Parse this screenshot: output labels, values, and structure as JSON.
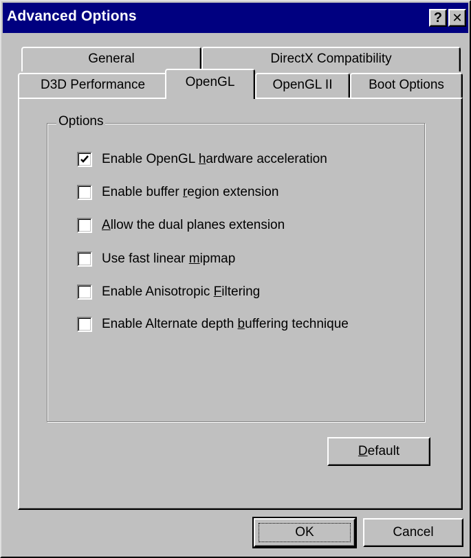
{
  "window": {
    "title": "Advanced Options",
    "help_glyph": "?",
    "close_glyph": "✕"
  },
  "tabs": {
    "row_back": [
      {
        "label": "General"
      },
      {
        "label": "DirectX Compatibility"
      }
    ],
    "row_front": [
      {
        "label": "D3D Performance"
      },
      {
        "label": "OpenGL",
        "active": true
      },
      {
        "label": "OpenGL II"
      },
      {
        "label": "Boot Options"
      }
    ]
  },
  "options_group": {
    "title": "Options",
    "checkboxes": [
      {
        "pre": "Enable OpenGL ",
        "accel": "h",
        "post": "ardware acceleration",
        "checked": true
      },
      {
        "pre": "Enable buffer ",
        "accel": "r",
        "post": "egion extension",
        "checked": false
      },
      {
        "pre": "",
        "accel": "A",
        "post": "llow the dual planes extension",
        "checked": false
      },
      {
        "pre": "Use fast linear ",
        "accel": "m",
        "post": "ipmap",
        "checked": false
      },
      {
        "pre": "Enable Anisotropic ",
        "accel": "F",
        "post": "iltering",
        "checked": false
      },
      {
        "pre": "Enable Alternate depth ",
        "accel": "b",
        "post": "uffering technique",
        "checked": false
      }
    ]
  },
  "buttons": {
    "default": {
      "accel": "D",
      "rest": "efault"
    },
    "ok": "OK",
    "cancel": "Cancel"
  },
  "colors": {
    "title_bar": "#000080",
    "face": "#c0c0c0"
  }
}
